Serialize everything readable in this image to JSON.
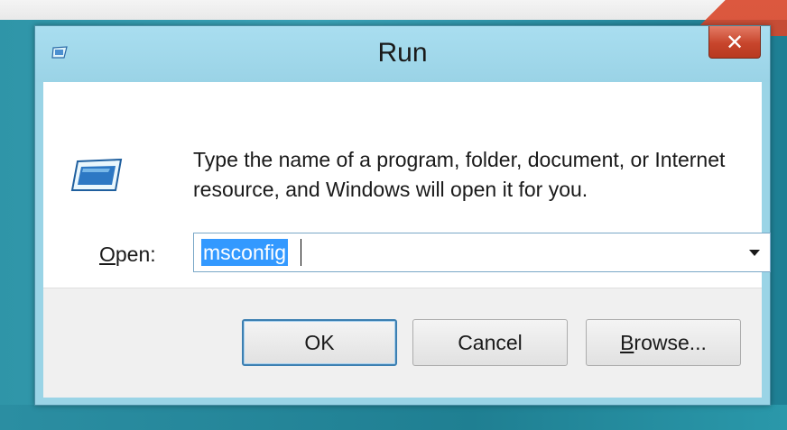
{
  "window": {
    "title": "Run",
    "message_line1": "Type the name of a program, folder, document, or Internet",
    "message_line2": "resource, and Windows will open it for you.",
    "open_label_mnemonic": "O",
    "open_label_rest": "pen:",
    "open_value": "msconfig"
  },
  "buttons": {
    "ok": "OK",
    "cancel": "Cancel",
    "browse_mnemonic": "B",
    "browse_rest": "rowse..."
  },
  "icons": {
    "title_icon": "run-icon",
    "big_icon": "run-icon",
    "close_icon": "close-icon",
    "dropdown_icon": "chevron-down-icon"
  },
  "colors": {
    "titlebar": "#9ad4e6",
    "close_button": "#c7452c",
    "selection": "#3399ff"
  }
}
